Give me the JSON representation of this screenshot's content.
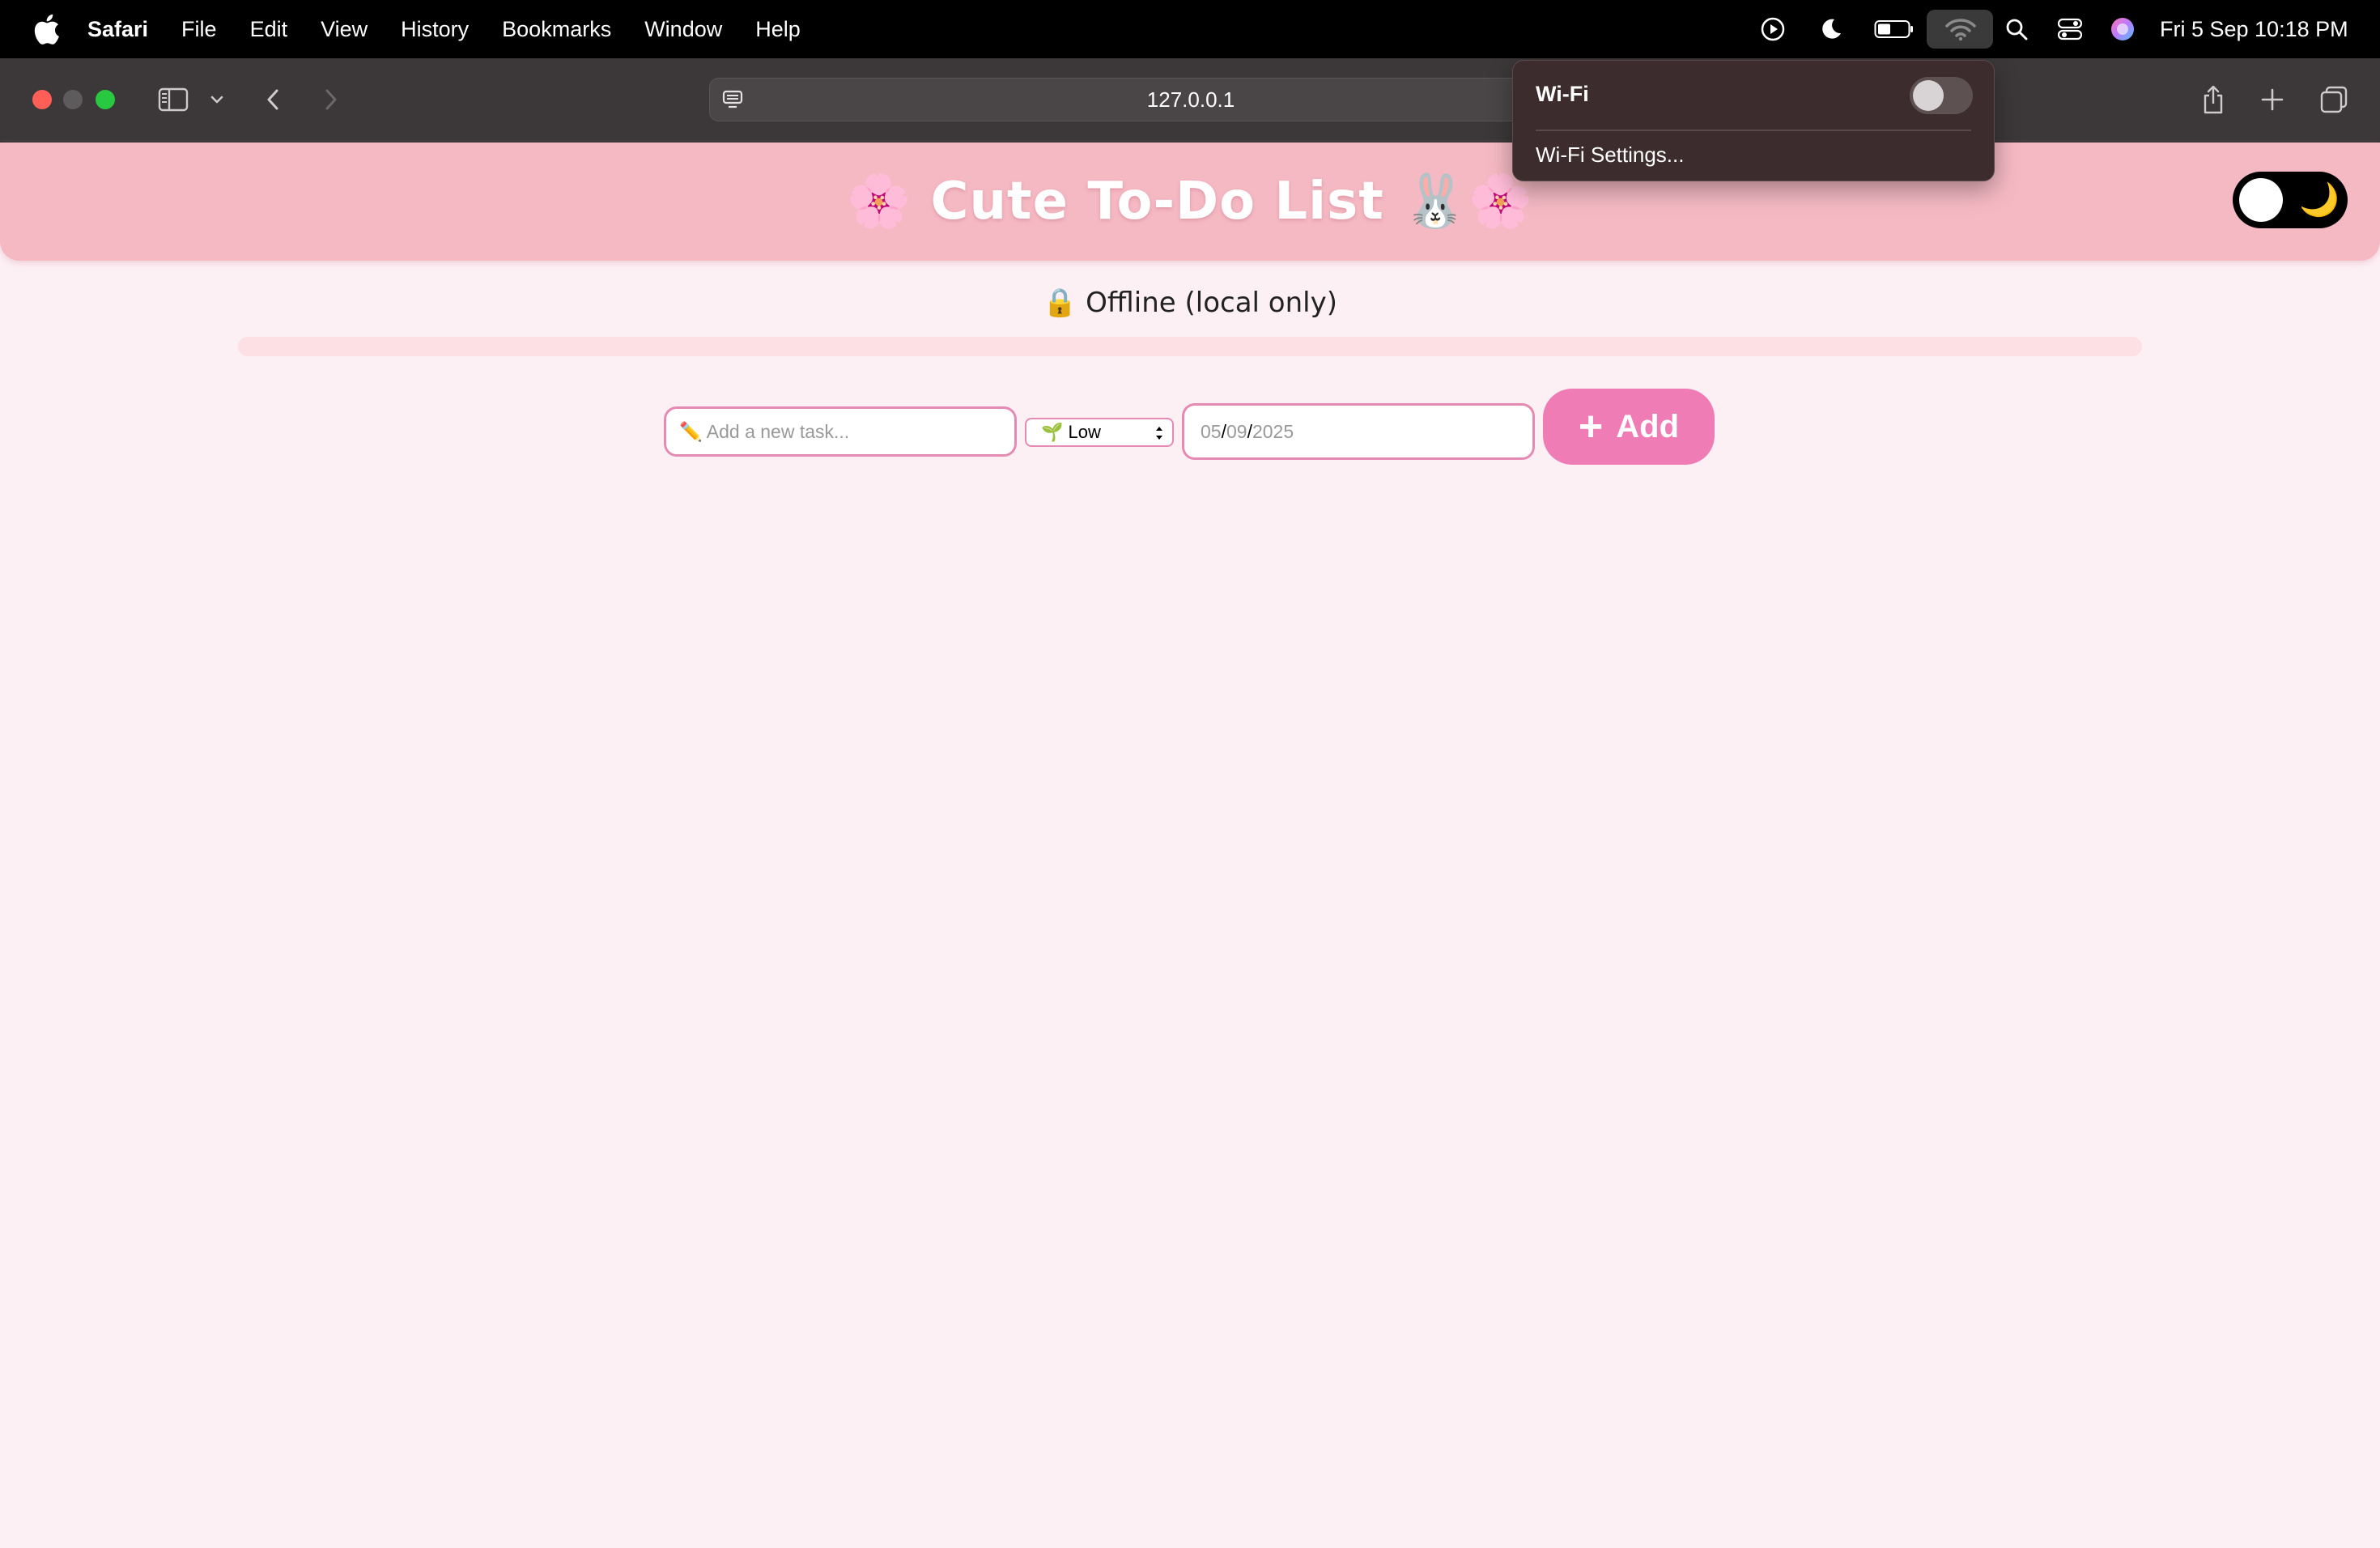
{
  "menubar": {
    "app_name": "Safari",
    "items": [
      "File",
      "Edit",
      "View",
      "History",
      "Bookmarks",
      "Window",
      "Help"
    ],
    "clock": "Fri 5 Sep  10:18 PM"
  },
  "browser": {
    "url": "127.0.0.1"
  },
  "wifi_menu": {
    "title": "Wi-Fi",
    "enabled": false,
    "settings_label": "Wi-Fi Settings..."
  },
  "app": {
    "title_emoji_left": "🌸",
    "title": "Cute To-Do List",
    "title_emoji_right": "🐰🌸",
    "theme_icon": "🌙",
    "status_icon": "🔒",
    "status": "Offline (local only)",
    "progress_percent": 0,
    "task_input": {
      "icon": "✏️",
      "placeholder": "Add a new task..."
    },
    "priority": {
      "icon": "🌱",
      "selected": "Low"
    },
    "date": {
      "day": "05",
      "month": "09",
      "year": "2025"
    },
    "add_button": {
      "icon": "+",
      "label": "Add"
    }
  },
  "colors": {
    "header": "#f5b9c3",
    "page_bg": "#fcf0f4",
    "accent": "#f07cb6",
    "border": "#e58bb3"
  }
}
